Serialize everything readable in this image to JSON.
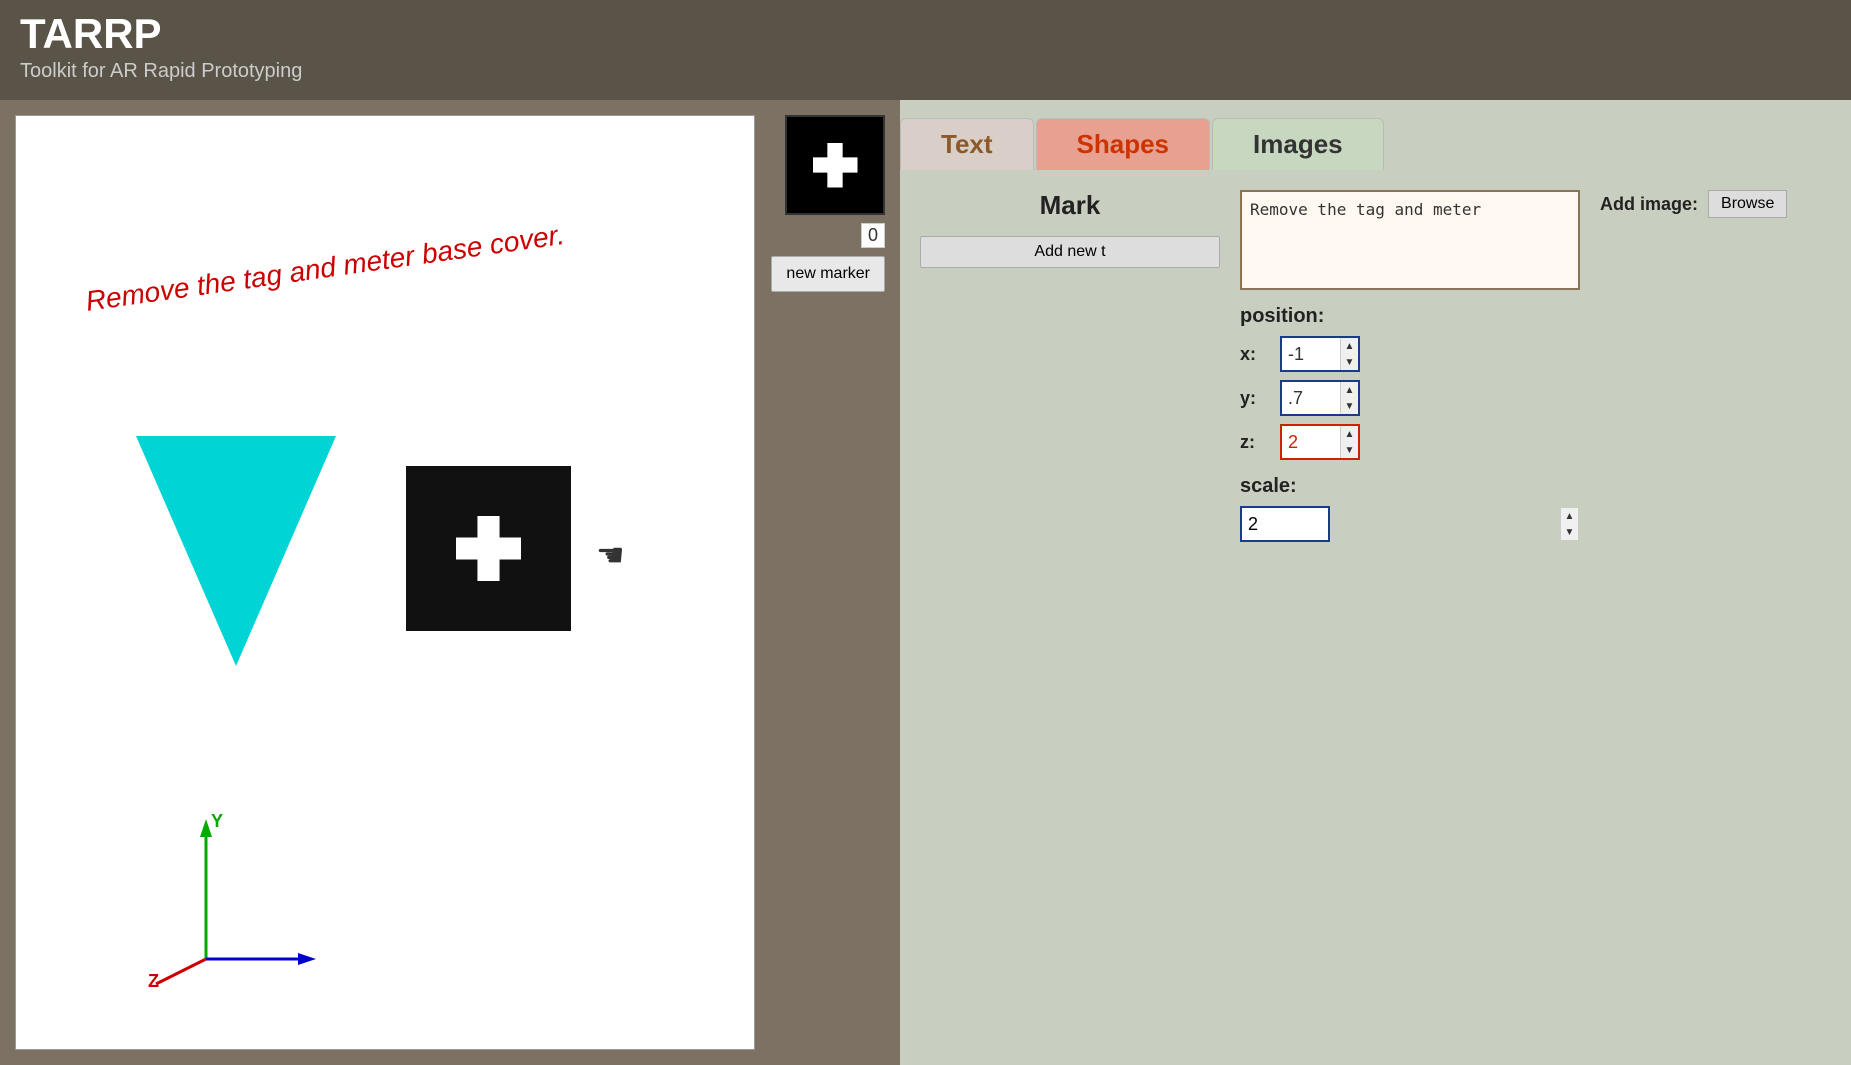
{
  "header": {
    "title": "TARRP",
    "subtitle": "Toolkit for AR Rapid Prototyping"
  },
  "viewport": {
    "ar_text": "Remove the tag and meter base cover.",
    "marker_label": "0",
    "new_marker_button": "new marker"
  },
  "tabs": {
    "text_label": "Text",
    "shapes_label": "Shapes",
    "images_label": "Images"
  },
  "text_panel": {
    "marker_title": "Mark",
    "add_new_text_label": "Add new t",
    "text_content": "Remove the tag and meter",
    "position_label": "position:",
    "x_label": "x:",
    "x_value": "-1",
    "y_label": "y:",
    "y_value": ".7",
    "z_label": "z:",
    "z_value": "2",
    "scale_label": "scale:",
    "scale_value": "2"
  },
  "images_panel": {
    "add_image_label": "Add image:",
    "browse_label": "Browse"
  },
  "axes": {
    "y_label": "Y",
    "z_label": "Z"
  }
}
